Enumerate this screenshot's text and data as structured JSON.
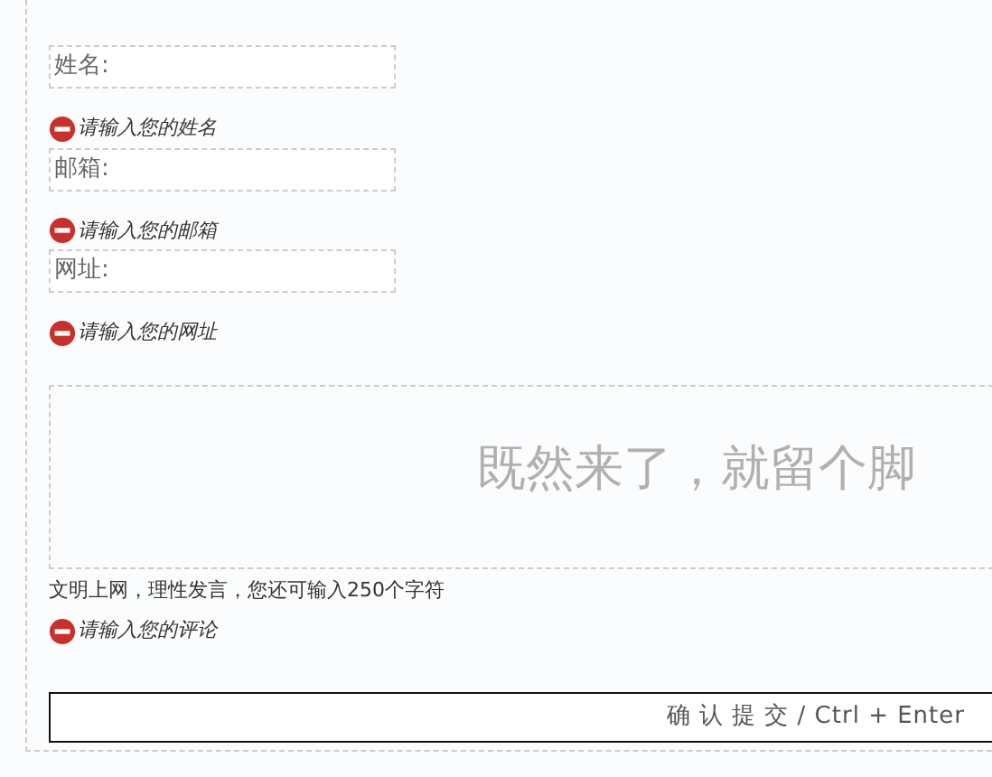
{
  "fields": [
    {
      "label": "姓名:",
      "error": "请输入您的姓名"
    },
    {
      "label": "邮箱:",
      "error": "请输入您的邮箱"
    },
    {
      "label": "网址:",
      "error": "请输入您的网址"
    }
  ],
  "comment": {
    "placeholder": "既然来了，就留个脚",
    "note": "文明上网，理性发言，您还可输入250个字符",
    "error": "请输入您的评论"
  },
  "submit": {
    "label": "确 认 提 交 / Ctrl + Enter"
  }
}
